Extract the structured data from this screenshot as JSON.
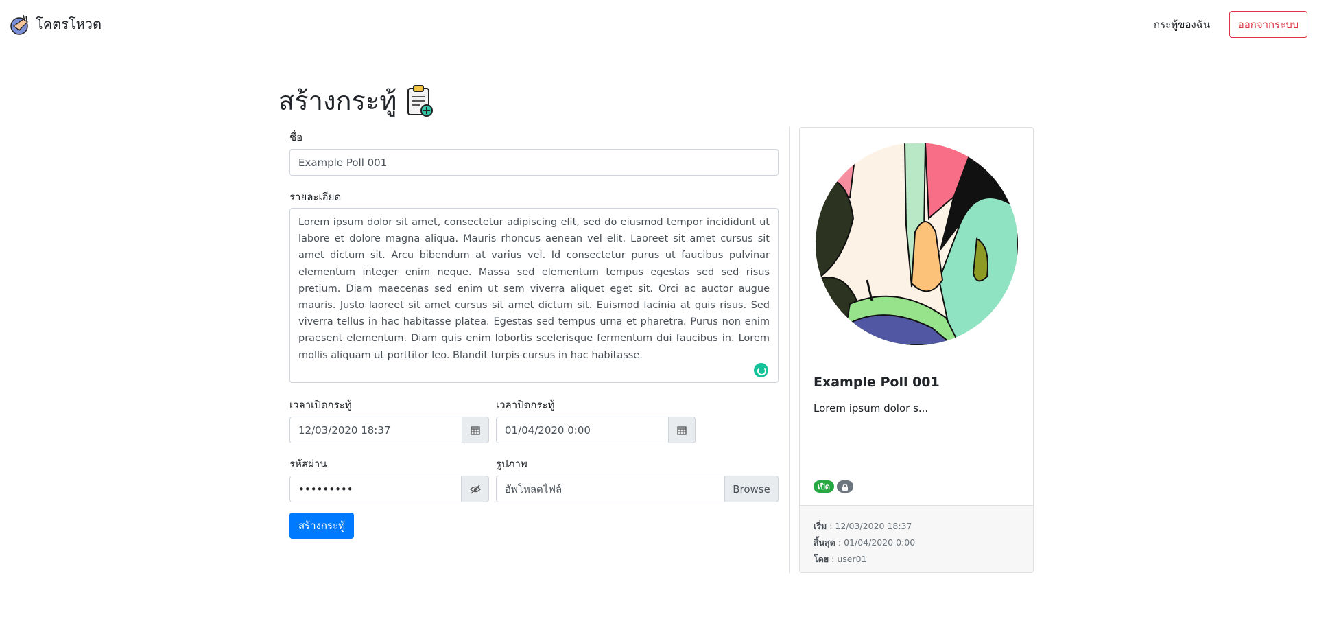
{
  "navbar": {
    "brand": "โคตรโหวต",
    "my_polls": "กระทู้ของฉัน",
    "logout": "ออกจากระบบ"
  },
  "page": {
    "title": "สร้างกระทู้"
  },
  "form": {
    "name_label": "ชื่อ",
    "name_value": "Example Poll 001",
    "detail_label": "รายละเอียด",
    "detail_value": "Lorem ipsum dolor sit amet, consectetur adipiscing elit, sed do eiusmod tempor incididunt ut labore et dolore magna aliqua. Mauris rhoncus aenean vel elit. Laoreet sit amet cursus sit amet dictum sit. Arcu bibendum at varius vel. Id consectetur purus ut faucibus pulvinar elementum integer enim neque. Massa sed elementum tempus egestas sed sed risus pretium. Diam maecenas sed enim ut sem viverra aliquet eget sit. Orci ac auctor augue mauris. Justo laoreet sit amet cursus sit amet dictum sit. Euismod lacinia at quis risus. Sed viverra tellus in hac habitasse platea. Egestas sed tempus urna et pharetra. Purus non enim praesent elementum. Diam quis enim lobortis scelerisque fermentum dui faucibus in. Lorem mollis aliquam ut porttitor leo. Blandit turpis cursus in hac habitasse.",
    "open_label": "เวลาเปิดกระทู้",
    "open_value": "12/03/2020 18:37",
    "close_label": "เวลาปิดกระทู้",
    "close_value": "01/04/2020 0:00",
    "password_label": "รหัสผ่าน",
    "password_value": "•••••••••",
    "image_label": "รูปภาพ",
    "image_placeholder": "อัพโหลดไฟล์",
    "browse": "Browse",
    "submit": "สร้างกระทู้"
  },
  "preview": {
    "title": "Example Poll 001",
    "desc": "Lorem ipsum dolor s...",
    "badge_open": "เปิด",
    "start_label": "เริ่ม",
    "start_value": "12/03/2020 18:37",
    "end_label": "สิ้นสุด",
    "end_value": "01/04/2020 0:00",
    "by_label": "โดย",
    "by_value": "user01"
  },
  "colors": {
    "primary": "#007bff",
    "danger": "#dc3545",
    "success": "#28a745",
    "secondary": "#6c757d"
  },
  "icons": [
    "hand-logo-icon",
    "clipboard-add-icon",
    "calendar-icon",
    "eye-slash-icon",
    "lock-icon",
    "grammarly-icon"
  ]
}
